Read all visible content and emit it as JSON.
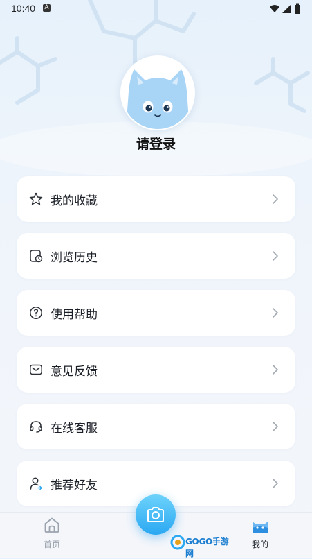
{
  "status_bar": {
    "time": "10:40",
    "notification_glyph": "A",
    "icons": [
      "wifi-icon",
      "signal-icon",
      "battery-icon"
    ]
  },
  "profile": {
    "login_text": "请登录",
    "avatar_icon": "cat-avatar-icon"
  },
  "menu": {
    "items": [
      {
        "label": "我的收藏",
        "icon": "star-icon"
      },
      {
        "label": "浏览历史",
        "icon": "history-icon"
      },
      {
        "label": "使用帮助",
        "icon": "help-icon"
      },
      {
        "label": "意见反馈",
        "icon": "mail-icon"
      },
      {
        "label": "在线客服",
        "icon": "headset-icon"
      },
      {
        "label": "推荐好友",
        "icon": "user-share-icon"
      }
    ]
  },
  "bottom_nav": {
    "tabs": [
      {
        "label": "首页",
        "icon": "home-icon",
        "active": false
      },
      {
        "label": "我的",
        "icon": "cat-face-icon",
        "active": true
      }
    ],
    "center_button_icon": "camera-icon"
  },
  "watermark": {
    "text": "GOGO手游网"
  },
  "colors": {
    "accent": "#2ba8f2",
    "card": "#ffffff",
    "text": "#1b1f27",
    "inactive": "#9aa3ae"
  }
}
